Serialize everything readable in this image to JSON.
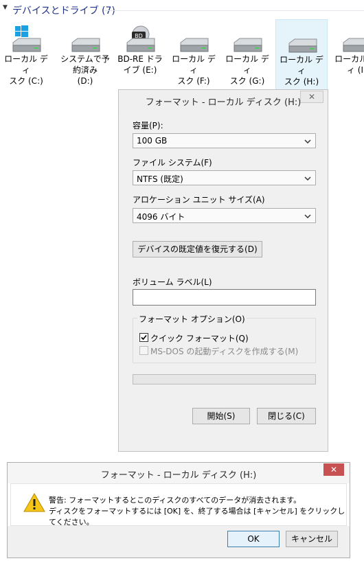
{
  "section": {
    "title": "デバイスとドライブ (7)"
  },
  "drives": [
    {
      "label": "ローカル ディ\nスク (C:)",
      "icon": "windows-drive-icon"
    },
    {
      "label": "システムで予\n約済み\n(D:)",
      "icon": "hard-drive-icon"
    },
    {
      "label": "BD-RE ドラ\nイブ (E:)",
      "icon": "bd-drive-icon",
      "badge": "BD"
    },
    {
      "label": "ローカル ディ\nスク (F:)",
      "icon": "hard-drive-icon"
    },
    {
      "label": "ローカル ディ\nスク (G:)",
      "icon": "hard-drive-icon"
    },
    {
      "label": "ローカル ディ\nスク (H:)",
      "icon": "hard-drive-icon",
      "selected": true
    },
    {
      "label": "ローカル デ\nィ (I:",
      "icon": "hard-drive-icon"
    }
  ],
  "format_dialog": {
    "title": "フォーマット - ローカル ディスク (H:)",
    "close_label": "✕",
    "capacity_label": "容量(P):",
    "capacity_value": "100 GB",
    "fs_label": "ファイル システム(F)",
    "fs_value": "NTFS (既定)",
    "alloc_label": "アロケーション ユニット サイズ(A)",
    "alloc_value": "4096 バイト",
    "restore_button": "デバイスの既定値を復元する(D)",
    "volume_label": "ボリューム ラベル(L)",
    "volume_value": "",
    "options_label": "フォーマット オプション(O)",
    "quick_format": "クイック フォーマット(Q)",
    "quick_format_checked": true,
    "msdos_disk": "MS-DOS の起動ディスクを作成する(M)",
    "msdos_checked": false,
    "progress_fraction": 0,
    "start_button": "開始(S)",
    "close_button": "閉じる(C)"
  },
  "warning_dialog": {
    "title": "フォーマット - ローカル ディスク (H:)",
    "close_label": "✕",
    "message_line1": "警告: フォーマットするとこのディスクのすべてのデータが消去されます。",
    "message_line2": "ディスクをフォーマットするには [OK] を、終了する場合は [キャンセル] をクリックしてください。",
    "ok_button": "OK",
    "cancel_button": "キャンセル"
  },
  "colors": {
    "section_title": "#1e3287",
    "selected_bg": "#e5f3fb",
    "close_red": "#c75050",
    "ok_border": "#3c7fb1"
  }
}
